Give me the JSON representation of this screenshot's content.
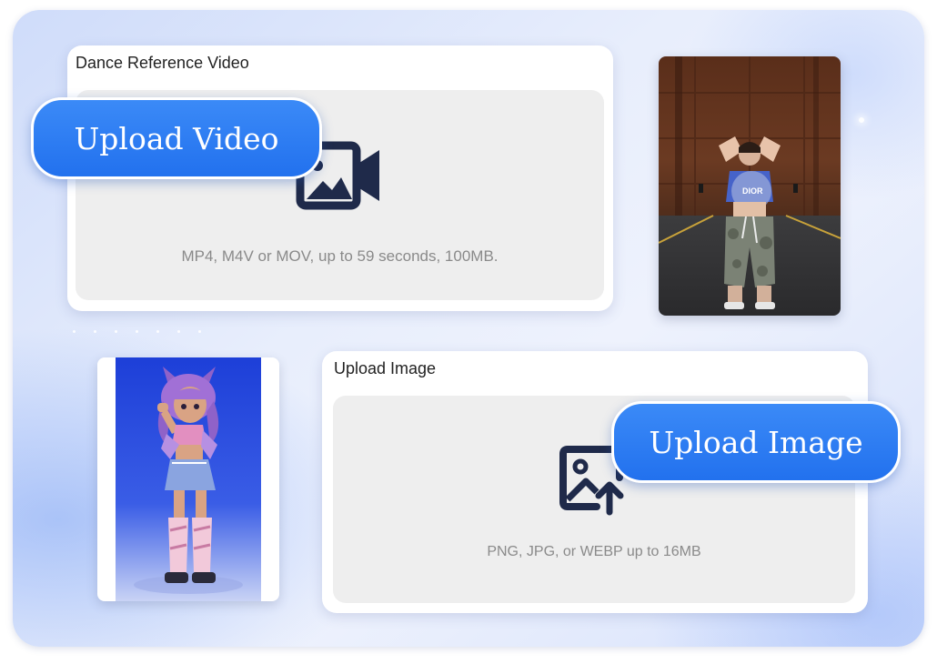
{
  "video_card": {
    "title": "Dance Reference Video",
    "hint": "MP4, M4V or MOV, up to 59 seconds, 100MB.",
    "button_label": "Upload Video",
    "icon": "video-image-icon"
  },
  "image_card": {
    "title": "Upload Image",
    "hint": "PNG, JPG, or WEBP up to 16MB",
    "button_label": "Upload Image",
    "icon": "image-upload-icon"
  },
  "dancer_photo": {
    "shirt_text": "DIOR"
  },
  "colors": {
    "accent": "#2a7bf2",
    "icon_navy": "#1f2a4a"
  }
}
